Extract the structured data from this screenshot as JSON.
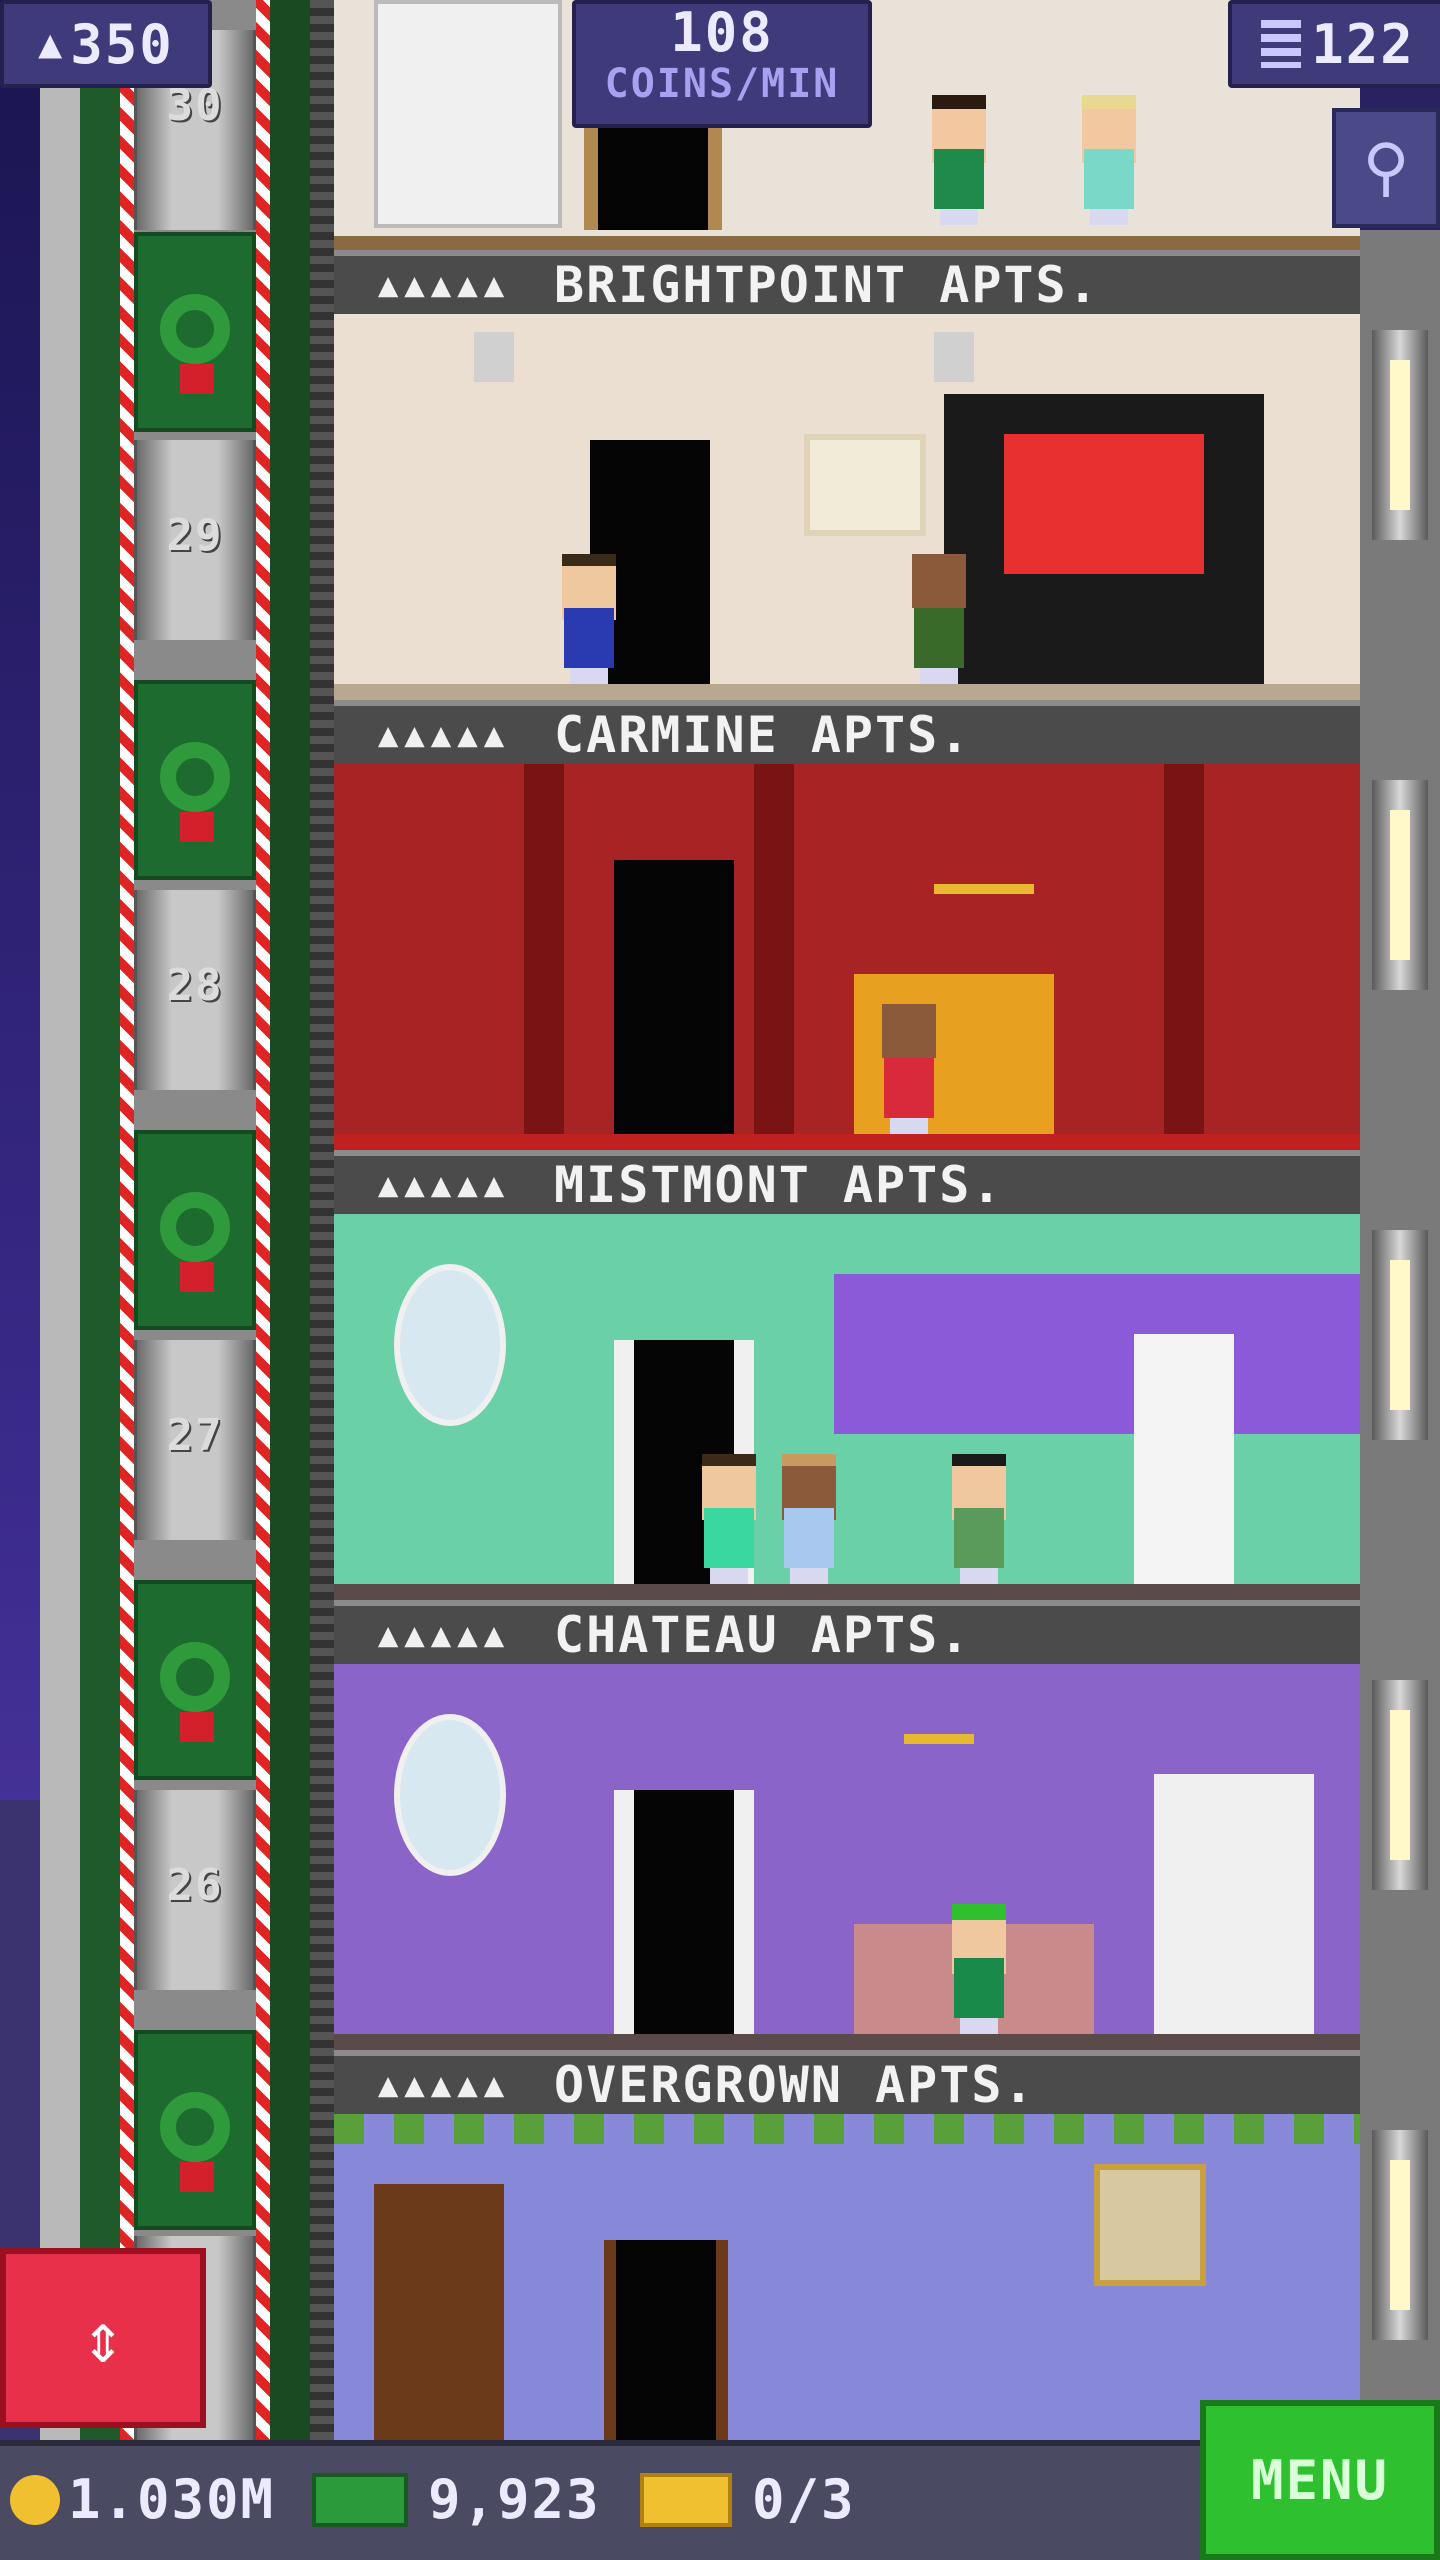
{
  "hud": {
    "population": "350",
    "population_icon": "person-icon",
    "coins_per_min_value": "108",
    "coins_per_min_label": "COINS/MIN",
    "floors_count": "122",
    "floors_icon": "building-icon",
    "zoom_icon": "magnifier-icon"
  },
  "elevator": {
    "floor_numbers": [
      "30",
      "29",
      "28",
      "27",
      "26"
    ],
    "button_icon": "up-down-arrows-icon"
  },
  "floors": [
    {
      "name": "BRIGHTPOINT APTS.",
      "stars": "▲▲▲▲▲",
      "theme": "beige"
    },
    {
      "name": "CARMINE APTS.",
      "stars": "▲▲▲▲▲",
      "theme": "red"
    },
    {
      "name": "MISTMONT APTS.",
      "stars": "▲▲▲▲▲",
      "theme": "mint"
    },
    {
      "name": "CHATEAU APTS.",
      "stars": "▲▲▲▲▲",
      "theme": "purple"
    },
    {
      "name": "OVERGROWN APTS.",
      "stars": "▲▲▲▲▲",
      "theme": "overgrown"
    }
  ],
  "bottom_bar": {
    "coins": "1.030M",
    "coins_icon": "coin-icon",
    "bux": "9,923",
    "bux_icon": "cash-icon",
    "tickets": "0/3",
    "tickets_icon": "ticket-icon",
    "menu_label": "MENU"
  },
  "colors": {
    "menu_green": "#2ec02e",
    "elevator_button_red": "#e8304a",
    "hud_purple": "#3f3a7a",
    "floor_header_gray": "#4b4b4b"
  }
}
